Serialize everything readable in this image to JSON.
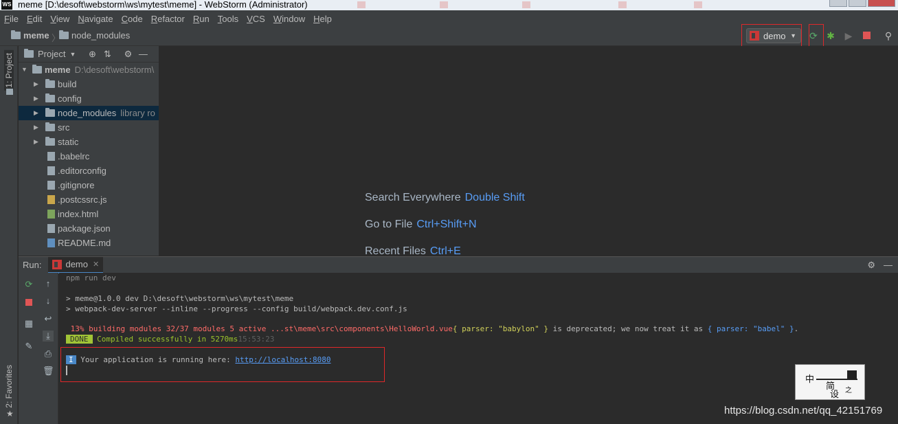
{
  "window": {
    "title": "meme [D:\\desoft\\webstorm\\ws\\mytest\\meme] - WebStorm (Administrator)",
    "logo": "WS"
  },
  "menu": [
    "File",
    "Edit",
    "View",
    "Navigate",
    "Code",
    "Refactor",
    "Run",
    "Tools",
    "VCS",
    "Window",
    "Help"
  ],
  "breadcrumb": {
    "root": "meme",
    "child": "node_modules"
  },
  "run_config": {
    "name": "demo"
  },
  "toolbar_icons": [
    "rerun-icon",
    "debug-icon",
    "coverage-icon",
    "stop-icon",
    "search-icon"
  ],
  "left_stripe": {
    "project": "1: Project",
    "favorites": "2: Favorites"
  },
  "project_panel": {
    "title": "Project",
    "root": {
      "name": "meme",
      "path": "D:\\desoft\\webstorm\\"
    },
    "items": [
      {
        "name": "build",
        "type": "folder",
        "hint": ""
      },
      {
        "name": "config",
        "type": "folder",
        "hint": ""
      },
      {
        "name": "node_modules",
        "type": "folder",
        "hint": "library ro"
      },
      {
        "name": "src",
        "type": "folder",
        "hint": ""
      },
      {
        "name": "static",
        "type": "folder",
        "hint": ""
      },
      {
        "name": ".babelrc",
        "type": "file",
        "hint": ""
      },
      {
        "name": ".editorconfig",
        "type": "file",
        "hint": ""
      },
      {
        "name": ".gitignore",
        "type": "file",
        "hint": ""
      },
      {
        "name": ".postcssrc.js",
        "type": "js",
        "hint": ""
      },
      {
        "name": "index.html",
        "type": "html",
        "hint": ""
      },
      {
        "name": "package.json",
        "type": "file",
        "hint": ""
      },
      {
        "name": "README.md",
        "type": "md",
        "hint": ""
      }
    ]
  },
  "editor_hints": [
    {
      "label": "Search Everywhere",
      "key": "Double Shift"
    },
    {
      "label": "Go to File",
      "key": "Ctrl+Shift+N"
    },
    {
      "label": "Recent Files",
      "key": "Ctrl+E"
    }
  ],
  "run_window": {
    "label": "Run:",
    "tab": "demo",
    "console": {
      "cmd": "npm run dev",
      "line1": "> meme@1.0.0 dev D:\\desoft\\webstorm\\ws\\mytest\\meme",
      "line2": "> webpack-dev-server --inline --progress --config build/webpack.dev.conf.js",
      "warn_a": " 13% building modules 32/37 modules 5 active ...st\\meme\\src\\components\\HelloWorld.vue",
      "warn_b": "{ parser: \"babylon\" }",
      "warn_c": " is deprecated; we now treat it as ",
      "warn_d": "{ parser: \"babel\" }",
      "warn_e": ".",
      "done_badge": "DONE",
      "done_text": " Compiled successfully in 5270ms",
      "done_time": "15:53:23",
      "info_badge": "I",
      "info_text": " Your application is running here: ",
      "info_url": "http://localhost:8080"
    }
  },
  "watermark": {
    "text": "https://blog.csdn.net/qq_42151769",
    "logo_chars": [
      "中",
      "简",
      "设",
      "之"
    ]
  }
}
